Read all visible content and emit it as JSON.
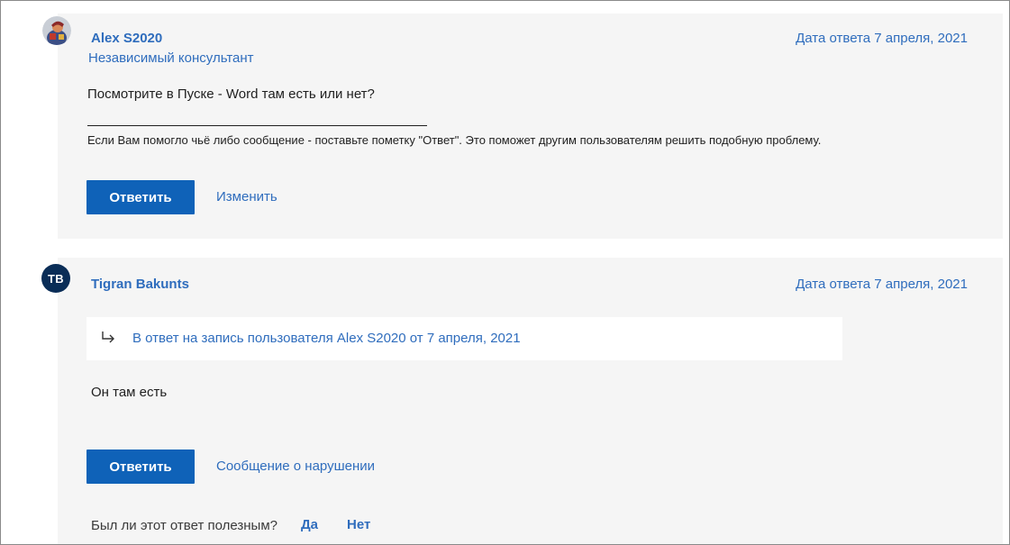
{
  "posts": [
    {
      "author": "Alex S2020",
      "role": "Независимый консультант",
      "date": "Дата ответа 7 апреля, 2021",
      "text": "Посмотрите в Пуске - Word там есть или нет?",
      "signature": "Если Вам помогло чьё либо сообщение - поставьте пометку \"Ответ\". Это поможет другим пользователям решить подобную проблему.",
      "reply_label": "Ответить",
      "secondary_link": "Изменить"
    },
    {
      "initials": "TB",
      "author": "Tigran Bakunts",
      "date": "Дата ответа 7 апреля, 2021",
      "quote": "В ответ на запись пользователя Alex S2020 от 7 апреля, 2021",
      "text": "Он там есть",
      "reply_label": "Ответить",
      "secondary_link": "Сообщение о нарушении",
      "helpful_question": "Был ли этот ответ полезным?",
      "yes_label": "Да",
      "no_label": "Нет"
    }
  ],
  "colors": {
    "link": "#2f6dbd",
    "button": "#0f62b8",
    "card": "#f5f5f5",
    "avatar_tb": "#0a2d57"
  },
  "icons": [
    "user-avatar-image",
    "reply-arrow-icon"
  ]
}
